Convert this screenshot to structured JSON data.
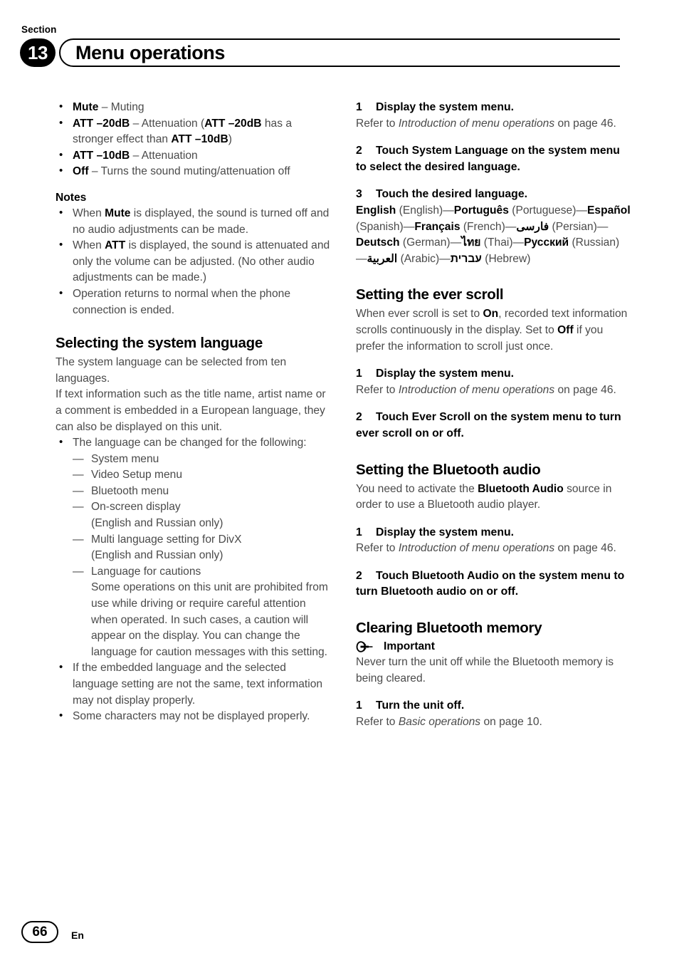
{
  "header": {
    "section_label": "Section",
    "section_number": "13",
    "title": "Menu operations"
  },
  "left_column": {
    "setting_options": [
      {
        "term": "Mute",
        "dash": " – ",
        "desc": "Muting"
      },
      {
        "term": "ATT –20dB",
        "dash": " – ",
        "desc": "Attenuation (",
        "term2": "ATT –20dB",
        "desc2": " has a stronger effect than ",
        "term3": "ATT –10dB",
        "desc3": ")"
      },
      {
        "term": "ATT –10dB",
        "dash": " – ",
        "desc": "Attenuation"
      },
      {
        "term": "Off",
        "dash": " – ",
        "desc": "Turns the sound muting/attenuation off"
      }
    ],
    "notes_heading": "Notes",
    "notes": [
      {
        "pre": "When ",
        "bold": "Mute",
        "post": " is displayed, the sound is turned off and no audio adjustments can be made."
      },
      {
        "pre": "When ",
        "bold": "ATT",
        "post": " is displayed, the sound is attenuated and only the volume can be adjusted. (No other audio adjustments can be made.)"
      },
      {
        "pre": "Operation returns to normal when the phone connection is ended.",
        "bold": "",
        "post": ""
      }
    ],
    "section_heading": "Selecting the system language",
    "intro_paragraph_1": "The system language can be selected from ten languages.",
    "intro_paragraph_2": "If text information such as the title name, artist name or a comment is embedded in a European language, they can also be displayed on this unit.",
    "bullet_changed_for": "The language can be changed for the following:",
    "sub_items": [
      {
        "text": "System menu",
        "note": ""
      },
      {
        "text": "Video Setup menu",
        "note": ""
      },
      {
        "text": "Bluetooth menu",
        "note": ""
      },
      {
        "text": "On-screen display",
        "note": "(English and Russian only)"
      },
      {
        "text": "Multi language setting for DivX",
        "note": "(English and Russian only)"
      },
      {
        "text": "Language for cautions",
        "note": "Some operations on this unit are prohibited from use while driving or require careful attention when operated. In such cases, a caution will appear on the display. You can change the language for caution messages with this setting."
      }
    ],
    "closing_bullets": [
      "If the embedded language and the selected language setting are not the same, text information may not display properly.",
      "Some characters may not be displayed properly."
    ]
  },
  "right_column": {
    "language_steps": [
      {
        "num": "1",
        "head": "Display the system menu.",
        "body_pre": "Refer to ",
        "body_italic": "Introduction of menu operations",
        "body_post": " on page 46."
      },
      {
        "num": "2",
        "head": "Touch System Language on the system menu to select the desired language.",
        "body_pre": "",
        "body_italic": "",
        "body_post": ""
      },
      {
        "num": "3",
        "head": "Touch the desired language.",
        "body_pre": "",
        "body_italic": "",
        "body_post": ""
      }
    ],
    "languages": [
      {
        "native": "English",
        "english": "(English)"
      },
      {
        "native": "Português",
        "english": "(Portuguese)"
      },
      {
        "native": "Español",
        "english": "(Spanish)"
      },
      {
        "native": "Français",
        "english": "(French)"
      },
      {
        "native": "فارسی",
        "english": "(Persian)"
      },
      {
        "native": "Deutsch",
        "english": "(German)"
      },
      {
        "native": "ไทย",
        "english": "(Thai)"
      },
      {
        "native": "Русский",
        "english": "(Russian)"
      },
      {
        "native": "العربية",
        "english": "(Arabic)"
      },
      {
        "native": "עברית",
        "english": "(Hebrew)"
      }
    ],
    "ever_scroll": {
      "heading": "Setting the ever scroll",
      "para_1": "When ever scroll is set to ",
      "bold_on": "On",
      "para_2": ", recorded text information scrolls continuously in the display. Set to ",
      "bold_off": "Off",
      "para_3": " if you prefer the information to scroll just once.",
      "steps": [
        {
          "num": "1",
          "head": "Display the system menu.",
          "body_pre": "Refer to ",
          "body_italic": "Introduction of menu operations",
          "body_post": " on page 46."
        },
        {
          "num": "2",
          "head": "Touch Ever Scroll on the system menu to turn ever scroll on or off.",
          "body_pre": "",
          "body_italic": "",
          "body_post": ""
        }
      ]
    },
    "bluetooth_audio": {
      "heading": "Setting the Bluetooth audio",
      "para_pre": "You need to activate the ",
      "para_bold": "Bluetooth Audio",
      "para_post": " source in order to use a Bluetooth audio player.",
      "steps": [
        {
          "num": "1",
          "head": "Display the system menu.",
          "body_pre": "Refer to ",
          "body_italic": "Introduction of menu operations",
          "body_post": " on page 46."
        },
        {
          "num": "2",
          "head": "Touch Bluetooth Audio on the system menu to turn Bluetooth audio on or off.",
          "body_pre": "",
          "body_italic": "",
          "body_post": ""
        }
      ]
    },
    "clearing_memory": {
      "heading": "Clearing Bluetooth memory",
      "important_label": "Important",
      "important_text": "Never turn the unit off while the Bluetooth memory is being cleared.",
      "steps": [
        {
          "num": "1",
          "head": "Turn the unit off.",
          "body_pre": "Refer to ",
          "body_italic": "Basic operations",
          "body_post": " on page 10."
        }
      ]
    }
  },
  "footer": {
    "page_number": "66",
    "language_code": "En"
  }
}
